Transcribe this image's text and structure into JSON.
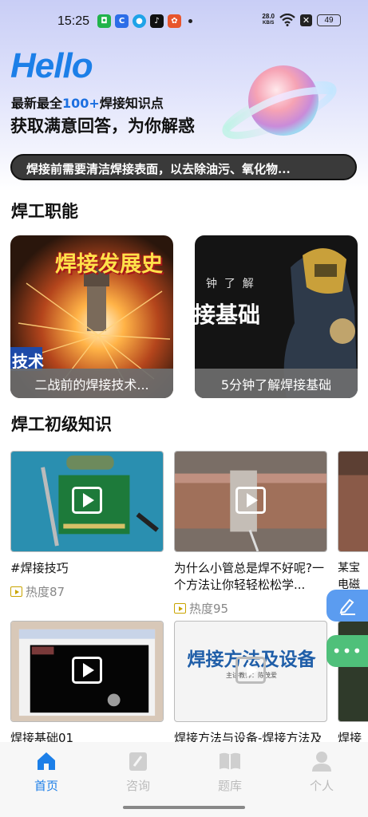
{
  "status_bar": {
    "time": "15:25",
    "net_speed_value": "28.0",
    "net_speed_unit": "KB/S",
    "battery": "49"
  },
  "hero": {
    "hello": "Hello",
    "tagline1_prefix": "最新最全",
    "tagline1_highlight": "100+",
    "tagline1_suffix": "焊接知识点",
    "tagline2": "获取满意回答，为你解惑"
  },
  "notice": "焊接前需要清洁焊接表面，以去除油污、氧化物...",
  "section_jobs": {
    "title": "焊工职能",
    "cards": [
      {
        "overlay": "焊接发展史",
        "corner": "技术",
        "caption": "二战前的焊接技术..."
      },
      {
        "overlay_small": "钟  了  解",
        "overlay": "接基础",
        "caption": "5分钟了解焊接基础"
      }
    ]
  },
  "section_basics": {
    "title": "焊工初级知识",
    "videos": [
      {
        "title": "#焊接技巧",
        "heat": "热度87"
      },
      {
        "title": "为什么小管总是焊不好呢?一个方法让你轻轻松松学...",
        "heat": "热度95"
      },
      {
        "title": "某宝电磁"
      },
      {
        "title": "焊接基础01"
      },
      {
        "title": "焊接方法与设备-焊接方法及",
        "thumb_text": "焊接方法及设备",
        "thumb_sub": "主讲教师：陈茂爱"
      },
      {
        "title": "焊接"
      }
    ]
  },
  "tabbar": [
    {
      "label": "首页",
      "icon": "home-icon",
      "active": true
    },
    {
      "label": "咨询",
      "icon": "consult-icon",
      "active": false
    },
    {
      "label": "题库",
      "icon": "book-icon",
      "active": false
    },
    {
      "label": "个人",
      "icon": "person-icon",
      "active": false
    }
  ],
  "colors": {
    "accent": "#1c7fe8",
    "heat_icon": "#c9a400",
    "float_blue": "#5b9cf0",
    "float_green": "#4fc07a"
  }
}
